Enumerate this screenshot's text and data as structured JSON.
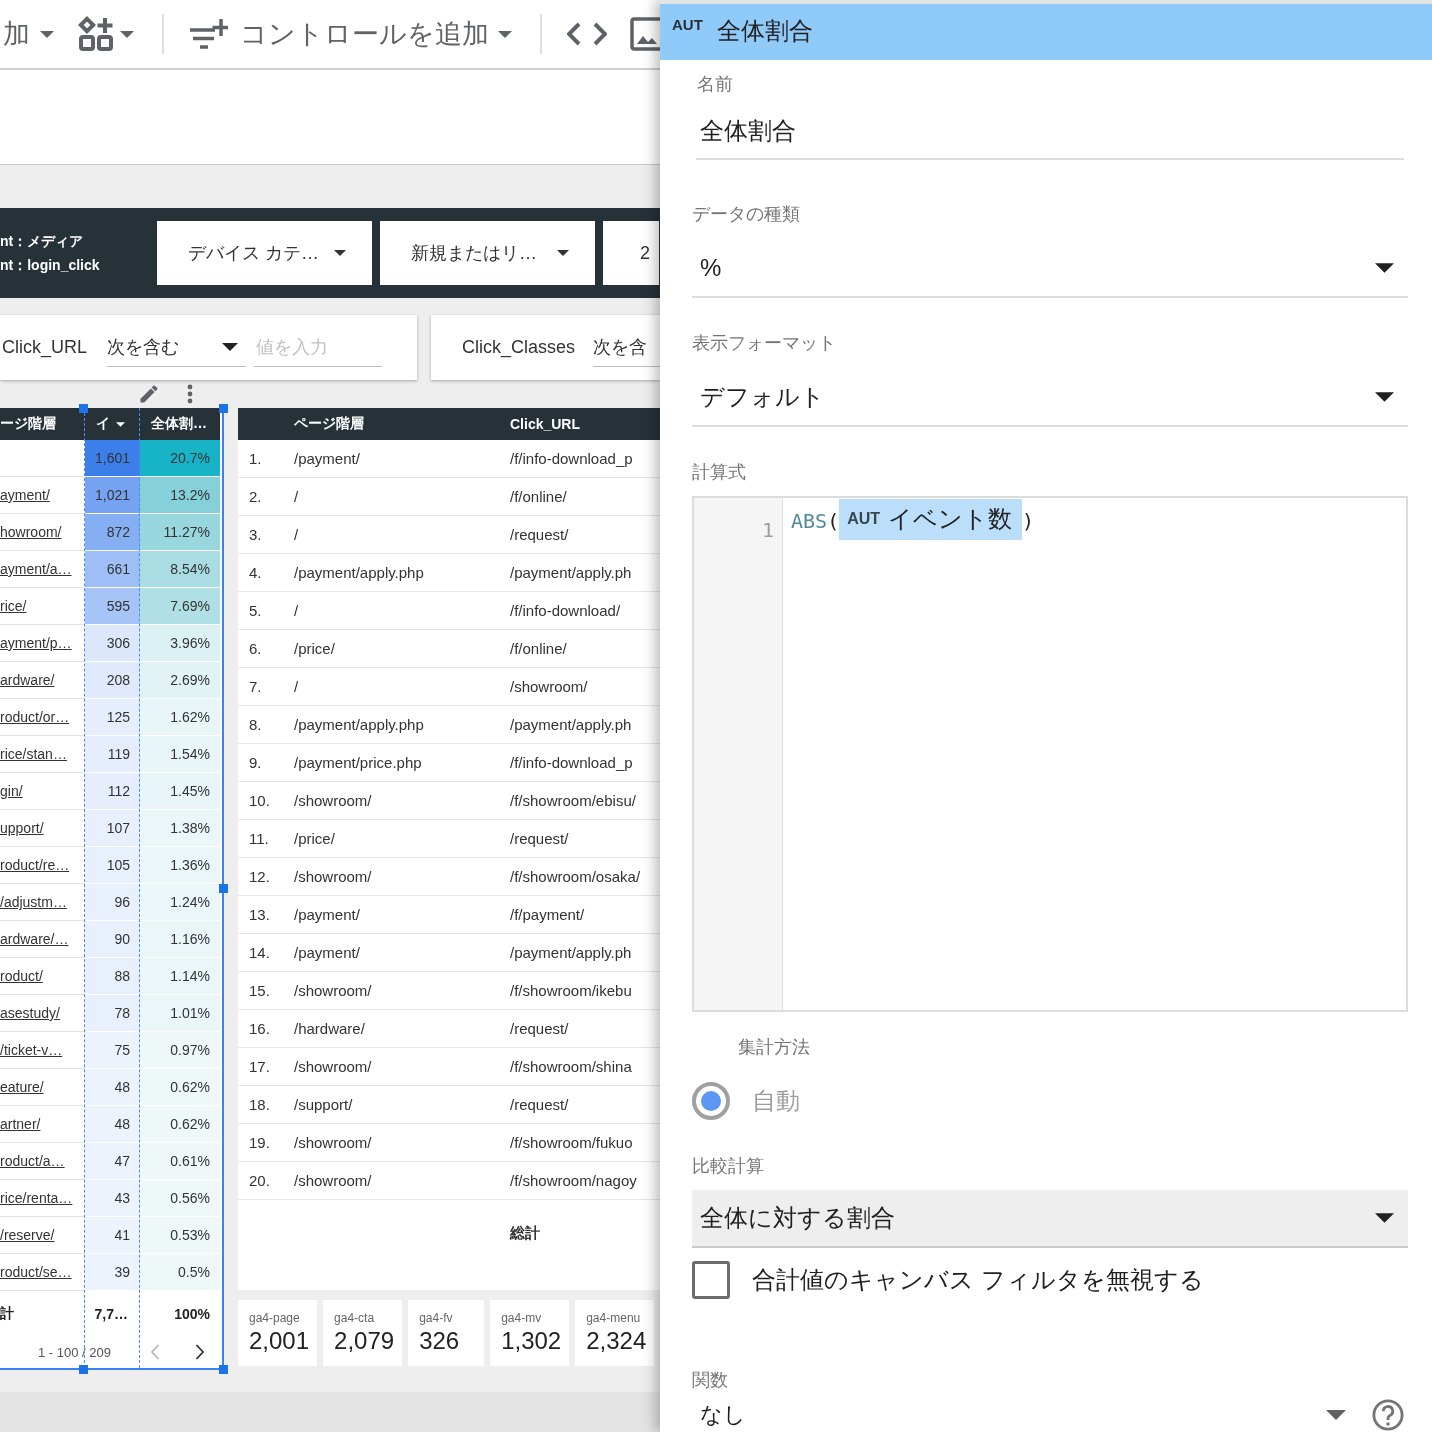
{
  "toolbar": {
    "add_label": "加",
    "control_label": "コントロールを追加"
  },
  "filter_bar": {
    "conditions": [
      "nt：メディア",
      "nt：login_click"
    ],
    "dropdowns": [
      "デバイス カテ…",
      "新規またはリ…"
    ],
    "cut_dropdown": "2"
  },
  "filter_controls": [
    {
      "kind": "full",
      "field": "Click_URL",
      "operator": "次を含む",
      "placeholder": "値を入力"
    },
    {
      "kind": "partial",
      "field": "Click_Classes",
      "operator": "次を含"
    }
  ],
  "left_table": {
    "columns": [
      "ージ階層",
      "イ",
      "全体割…"
    ],
    "rows": [
      {
        "events": {
          "text": "1,601",
          "color": "#3d7fea"
        },
        "share": {
          "text": "20.7%",
          "color": "#17b3c6"
        }
      },
      {
        "page": "ayment/",
        "events": {
          "text": "1,021",
          "color": "#76a3f1"
        },
        "share": {
          "text": "13.2%",
          "color": "#86d0d9"
        }
      },
      {
        "page": "howroom/",
        "events": {
          "text": "872",
          "color": "#86aef3"
        },
        "share": {
          "text": "11.27%",
          "color": "#98d7de"
        }
      },
      {
        "page": "ayment/a…",
        "events": {
          "text": "661",
          "color": "#9ebff5"
        },
        "share": {
          "text": "8.54%",
          "color": "#a9dde3"
        }
      },
      {
        "page": "rice/",
        "events": {
          "text": "595",
          "color": "#a6c4f6"
        },
        "share": {
          "text": "7.69%",
          "color": "#b0e0e5"
        }
      },
      {
        "page": "ayment/p…",
        "events": {
          "text": "306",
          "color": "#dce7fc"
        },
        "share": {
          "text": "3.96%",
          "color": "#dcf1f4"
        }
      },
      {
        "page": "ardware/",
        "events": {
          "text": "208",
          "color": "#e0eafc"
        },
        "share": {
          "text": "2.69%",
          "color": "#e1f3f5"
        }
      },
      {
        "page": "roduct/or…",
        "events": {
          "text": "125",
          "color": "#e6eefd"
        },
        "share": {
          "text": "1.62%",
          "color": "#e8f6f7"
        }
      },
      {
        "page": "rice/stan…",
        "events": {
          "text": "119",
          "color": "#e6eefd"
        },
        "share": {
          "text": "1.54%",
          "color": "#e8f6f7"
        }
      },
      {
        "page": "gin/",
        "events": {
          "text": "112",
          "color": "#e6eefd"
        },
        "share": {
          "text": "1.45%",
          "color": "#e8f6f7"
        }
      },
      {
        "page": "upport/",
        "events": {
          "text": "107",
          "color": "#e9f0fd"
        },
        "share": {
          "text": "1.38%",
          "color": "#eaf6f8"
        }
      },
      {
        "page": "roduct/re…",
        "events": {
          "text": "105",
          "color": "#e9f0fd"
        },
        "share": {
          "text": "1.36%",
          "color": "#eaf6f8"
        }
      },
      {
        "page": "/adjustm…",
        "events": {
          "text": "96",
          "color": "#e9f0fd"
        },
        "share": {
          "text": "1.24%",
          "color": "#eaf6f8"
        }
      },
      {
        "page": "ardware/…",
        "events": {
          "text": "90",
          "color": "#e9f0fd"
        },
        "share": {
          "text": "1.16%",
          "color": "#eaf6f8"
        }
      },
      {
        "page": "roduct/",
        "events": {
          "text": "88",
          "color": "#e9f0fd"
        },
        "share": {
          "text": "1.14%",
          "color": "#eaf6f8"
        }
      },
      {
        "page": "asestudy/",
        "events": {
          "text": "78",
          "color": "#e9f0fd"
        },
        "share": {
          "text": "1.01%",
          "color": "#eaf6f8"
        }
      },
      {
        "page": "/ticket-v…",
        "events": {
          "text": "75",
          "color": "#edf3fd"
        },
        "share": {
          "text": "0.97%",
          "color": "#eef8f9"
        }
      },
      {
        "page": "eature/",
        "events": {
          "text": "48",
          "color": "#edf3fd"
        },
        "share": {
          "text": "0.62%",
          "color": "#eef8f9"
        }
      },
      {
        "page": "artner/",
        "events": {
          "text": "48",
          "color": "#edf3fd"
        },
        "share": {
          "text": "0.62%",
          "color": "#eef8f9"
        }
      },
      {
        "page": "roduct/a…",
        "events": {
          "text": "47",
          "color": "#edf3fd"
        },
        "share": {
          "text": "0.61%",
          "color": "#eef8f9"
        }
      },
      {
        "page": "rice/renta…",
        "events": {
          "text": "43",
          "color": "#edf3fd"
        },
        "share": {
          "text": "0.56%",
          "color": "#eef8f9"
        }
      },
      {
        "page": "/reserve/",
        "events": {
          "text": "41",
          "color": "#edf3fd"
        },
        "share": {
          "text": "0.53%",
          "color": "#eef8f9"
        }
      },
      {
        "page": "roduct/se…",
        "events": {
          "text": "39",
          "color": "#edf3fd"
        },
        "share": {
          "text": "0.5%",
          "color": "#eef8f9"
        }
      }
    ],
    "total": {
      "label": "計",
      "events": "7,7…",
      "share": "100%"
    },
    "pagination": "1 - 100 / 209"
  },
  "table": {
    "columns": [
      "ページ階層",
      "Click_URL"
    ],
    "rows": [
      {
        "index": "1.",
        "page": "/payment/",
        "click_url": "/f/info-download_p"
      },
      {
        "index": "2.",
        "page": "/",
        "click_url": "/f/online/"
      },
      {
        "index": "3.",
        "page": "/",
        "click_url": "/request/"
      },
      {
        "index": "4.",
        "page": "/payment/apply.php",
        "click_url": "/payment/apply.ph"
      },
      {
        "index": "5.",
        "page": "/",
        "click_url": "/f/info-download/"
      },
      {
        "index": "6.",
        "page": "/price/",
        "click_url": "/f/online/"
      },
      {
        "index": "7.",
        "page": "/",
        "click_url": "/showroom/"
      },
      {
        "index": "8.",
        "page": "/payment/apply.php",
        "click_url": "/payment/apply.ph"
      },
      {
        "index": "9.",
        "page": "/payment/price.php",
        "click_url": "/f/info-download_p"
      },
      {
        "index": "10.",
        "page": "/showroom/",
        "click_url": "/f/showroom/ebisu/"
      },
      {
        "index": "11.",
        "page": "/price/",
        "click_url": "/request/"
      },
      {
        "index": "12.",
        "page": "/showroom/",
        "click_url": "/f/showroom/osaka/"
      },
      {
        "index": "13.",
        "page": "/payment/",
        "click_url": "/f/payment/"
      },
      {
        "index": "14.",
        "page": "/payment/",
        "click_url": "/payment/apply.ph"
      },
      {
        "index": "15.",
        "page": "/showroom/",
        "click_url": "/f/showroom/ikebu"
      },
      {
        "index": "16.",
        "page": "/hardware/",
        "click_url": "/request/"
      },
      {
        "index": "17.",
        "page": "/showroom/",
        "click_url": "/f/showroom/shina"
      },
      {
        "index": "18.",
        "page": "/support/",
        "click_url": "/request/"
      },
      {
        "index": "19.",
        "page": "/showroom/",
        "click_url": "/f/showroom/fukuo"
      },
      {
        "index": "20.",
        "page": "/showroom/",
        "click_url": "/f/showroom/nagoy"
      }
    ],
    "total_label": "総計"
  },
  "scorecards": [
    {
      "label": "ga4-page",
      "value": "2,001"
    },
    {
      "label": "ga4-cta",
      "value": "2,079"
    },
    {
      "label": "ga4-fv",
      "value": "326"
    },
    {
      "label": "ga4-mv",
      "value": "1,302"
    },
    {
      "label": "ga4-menu",
      "value": "2,324"
    }
  ],
  "panel": {
    "header": {
      "badge": "AUT",
      "title": "全体割合"
    },
    "name": {
      "label": "名前",
      "value": "全体割合"
    },
    "data_type": {
      "label": "データの種類",
      "value": "%"
    },
    "display_format": {
      "label": "表示フォーマット",
      "value": "デフォルト"
    },
    "formula": {
      "label": "計算式",
      "line_number": "1",
      "tokens": [
        {
          "kind": "function",
          "text": "ABS"
        },
        {
          "kind": "punct",
          "text": "("
        },
        {
          "kind": "field",
          "badge": "AUT",
          "text": "イベント数"
        },
        {
          "kind": "punct",
          "text": ")"
        }
      ]
    },
    "aggregation": {
      "label": "集計方法",
      "options": [
        {
          "label": "自動",
          "selected": true,
          "disabled": true
        }
      ]
    },
    "comparison": {
      "label": "比較計算",
      "value": "全体に対する割合"
    },
    "ignore_filters": {
      "label": "合計値のキャンバス フィルタを無視する",
      "checked": false
    },
    "function": {
      "label": "関数",
      "value": "なし"
    }
  }
}
